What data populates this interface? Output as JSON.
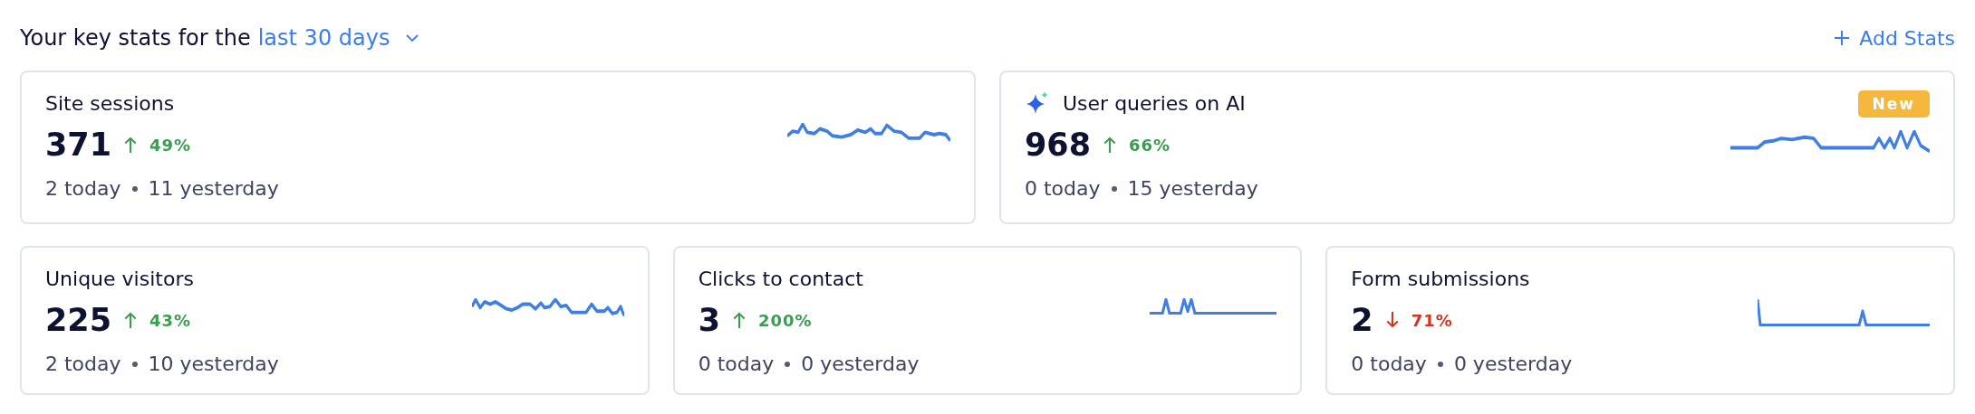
{
  "header": {
    "prefix": "Your key stats for the",
    "period": "last 30 days",
    "add_button": "Add Stats"
  },
  "rows": [
    [
      {
        "title": "Site sessions",
        "ai": false,
        "value": "371",
        "kind": "up",
        "change": "49%",
        "today": "2 today",
        "yesterday": "11 yesterday"
      },
      {
        "title": "User queries on AI",
        "ai": true,
        "badge": "New",
        "value": "968",
        "kind": "up",
        "change": "66%",
        "today": "0 today",
        "yesterday": "15 yesterday"
      }
    ],
    [
      {
        "title": "Unique visitors",
        "ai": false,
        "value": "225",
        "kind": "up",
        "change": "43%",
        "today": "2 today",
        "yesterday": "10 yesterday"
      },
      {
        "title": "Clicks to contact",
        "ai": false,
        "value": "3",
        "kind": "up",
        "change": "200%",
        "today": "0 today",
        "yesterday": "0 yesterday"
      },
      {
        "title": "Form submissions",
        "ai": false,
        "value": "2",
        "kind": "down",
        "change": "71%",
        "today": "0 today",
        "yesterday": "0 yesterday"
      }
    ]
  ]
}
